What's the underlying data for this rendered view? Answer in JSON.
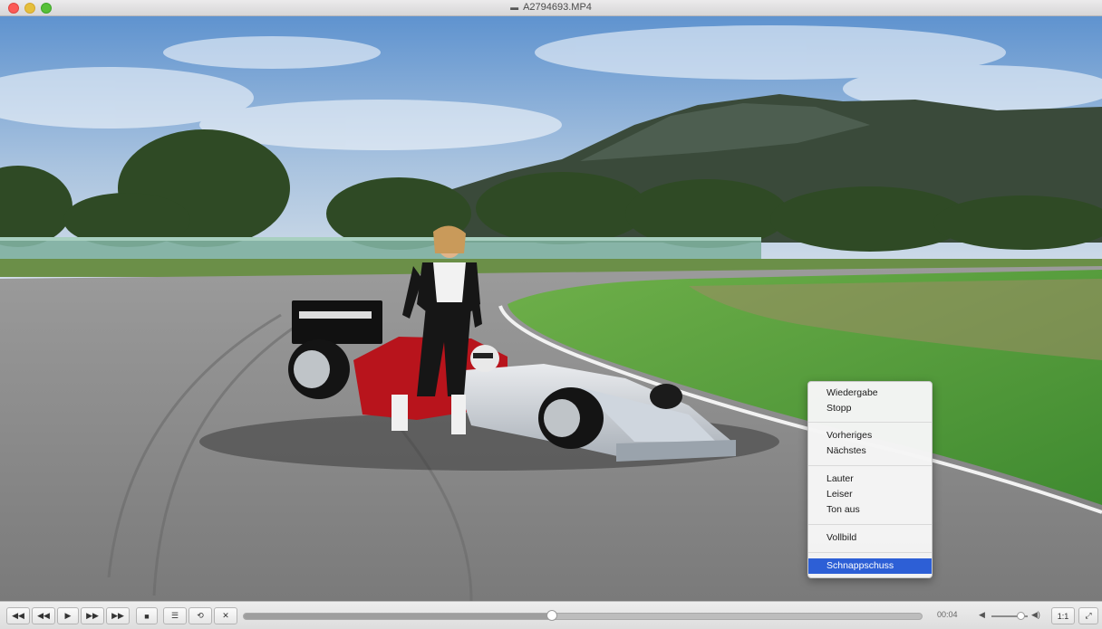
{
  "window": {
    "title": "A2794693.MP4",
    "title_icon": "film-strip-icon"
  },
  "context_menu": {
    "groups": [
      {
        "items": [
          {
            "label": "Wiedergabe"
          },
          {
            "label": "Stopp"
          }
        ]
      },
      {
        "items": [
          {
            "label": "Vorheriges"
          },
          {
            "label": "Nächstes"
          }
        ]
      },
      {
        "items": [
          {
            "label": "Lauter"
          },
          {
            "label": "Leiser"
          },
          {
            "label": "Ton aus"
          }
        ]
      },
      {
        "items": [
          {
            "label": "Vollbild"
          }
        ]
      },
      {
        "items": [
          {
            "label": "Schnappschuss",
            "selected": true
          }
        ]
      }
    ]
  },
  "controls": {
    "buttons": [
      {
        "name": "rewind-button",
        "icon": "rewind-icon",
        "glyph": "◀◀"
      },
      {
        "name": "step-back-button",
        "icon": "step-back-icon",
        "glyph": "◀◀"
      },
      {
        "name": "play-button",
        "icon": "play-icon",
        "glyph": "▶"
      },
      {
        "name": "step-forward-button",
        "icon": "step-forward-icon",
        "glyph": "▶▶"
      },
      {
        "name": "fast-forward-button",
        "icon": "fast-forward-icon",
        "glyph": "▶▶"
      },
      {
        "name": "stop-button",
        "icon": "stop-icon",
        "glyph": "■"
      },
      {
        "name": "playlist-button",
        "icon": "playlist-icon",
        "glyph": "☰"
      },
      {
        "name": "loop-button",
        "icon": "loop-icon",
        "glyph": "⟲"
      },
      {
        "name": "shuffle-button",
        "icon": "shuffle-icon",
        "glyph": "✕"
      }
    ],
    "progress_fraction": 0.455,
    "time_display": "00:04",
    "volume_fraction": 0.8,
    "aspect_label": "1:1",
    "fullscreen_icon": "expand-icon"
  },
  "colors": {
    "selection": "#2d5fd6",
    "sky": "#6e9cd0",
    "asphalt": "#8a8a8a",
    "grass": "#4f9a3e"
  }
}
